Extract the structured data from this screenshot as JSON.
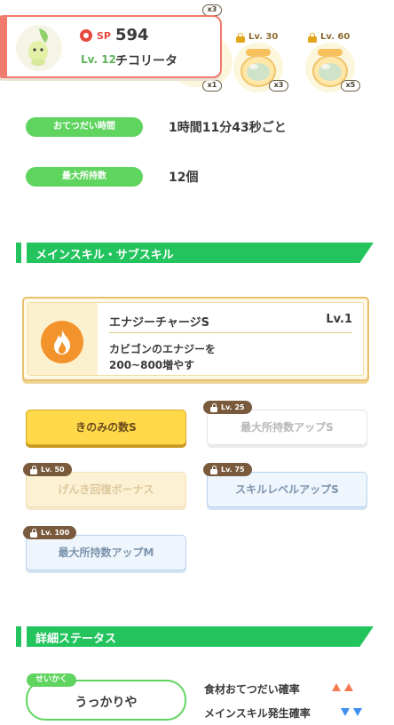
{
  "pokemon": {
    "sp_label": "SP",
    "sp_value": "594",
    "level": "Lv. 12",
    "name": "チコリータ"
  },
  "top_badge": "x3",
  "ingredients": [
    {
      "unlock": "",
      "count": "x1"
    },
    {
      "unlock": "Lv. 30",
      "count": "x3"
    },
    {
      "unlock": "Lv. 60",
      "count": "x5"
    }
  ],
  "info": {
    "help_time_label": "おてつだい時間",
    "help_time_value": "1時間11分43秒ごと",
    "max_carry_label": "最大所持数",
    "max_carry_value": "12個"
  },
  "skills_section": {
    "title": "メインスキル・サブスキル"
  },
  "main_skill": {
    "name": "エナジーチャージS",
    "level": "Lv.1",
    "desc_line1": "カビゴンのエナジーを",
    "desc_line2": "200~800増やす"
  },
  "subskills": [
    {
      "unlock": "",
      "label": "きのみの数S"
    },
    {
      "unlock": "Lv. 25",
      "label": "最大所持数アップS"
    },
    {
      "unlock": "Lv. 50",
      "label": "げんき回復ボーナス"
    },
    {
      "unlock": "Lv. 75",
      "label": "スキルレベルアップS"
    },
    {
      "unlock": "Lv. 100",
      "label": "最大所持数アップM"
    }
  ],
  "detail_section": {
    "title": "詳細ステータス"
  },
  "nature": {
    "tag": "せいかく",
    "name": "うっかりや"
  },
  "stats": [
    {
      "label": "食材おてつだい確率",
      "direction": "up"
    },
    {
      "label": "メインスキル発生確率",
      "direction": "down"
    }
  ],
  "colors": {
    "accent_green": "#23c45e",
    "card_border": "#f07a6b",
    "gold_subskill": "#ffd94a",
    "blue_subskill": "#eef5fd",
    "up_arrow": "#f37b52",
    "down_arrow": "#3d8ff0"
  }
}
